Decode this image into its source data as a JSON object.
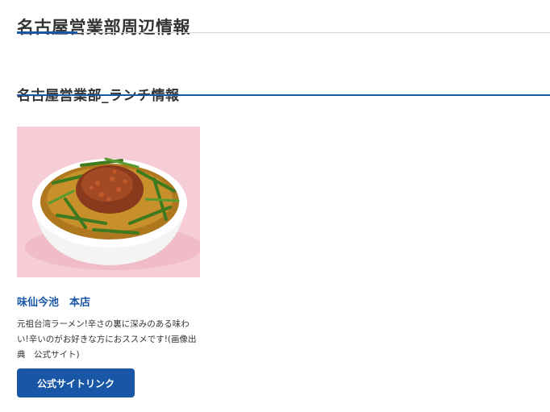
{
  "page": {
    "title": "名古屋営業部周辺情報"
  },
  "section": {
    "title": "名古屋営業部_ランチ情報"
  },
  "card": {
    "image_subject": "台湾ラーメン",
    "store_name": "味仙今池　本店",
    "description": "元祖台湾ラーメン!辛さの裏に深みのある味わい!辛いのがお好きな方におススメです!(画像出典　公式サイト)",
    "button_label": "公式サイトリンク"
  },
  "colors": {
    "accent": "#1a56a6",
    "text": "#333333",
    "rule": "#d6d6d6",
    "image_background": "#f6ccd6"
  }
}
